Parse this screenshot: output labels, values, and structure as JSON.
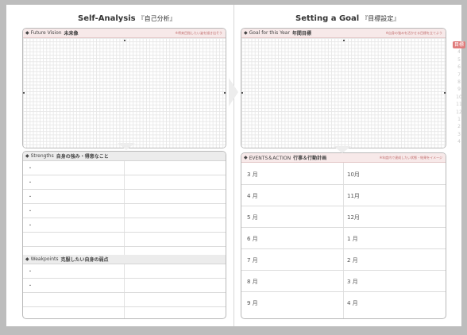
{
  "left_page": {
    "title": "Self-Analysis",
    "title_jp": "『自己分析』",
    "future_vision": {
      "label": "Future Vision",
      "label_jp": "未来像",
      "note": "※将来目指したい姿を描き出そう"
    },
    "strengths": {
      "label": "Strengths",
      "label_jp": "自身の強み・得意なこと",
      "bullets": [
        "・",
        "・",
        "・",
        "・",
        "・"
      ]
    },
    "weakpoints": {
      "label": "Weakpoints",
      "label_jp": "克服したい自身の弱点",
      "bullets": [
        "・",
        "・"
      ]
    }
  },
  "right_page": {
    "title": "Setting a Goal",
    "title_jp": "『目標設定』",
    "goal": {
      "label": "Goal for this Year",
      "label_jp": "年間目標",
      "note": "※自身の強みを活かせる目標を立てよう"
    },
    "events": {
      "label": "EVENTS＆ACTION",
      "label_jp": "行事＆行動計画",
      "note": "※年度内で達成したい状態・結果をイメージ",
      "months_left": [
        "3 月",
        "4 月",
        "5 月",
        "6 月",
        "7 月",
        "8 月",
        "9 月"
      ],
      "months_right": [
        "10月",
        "11月",
        "12月",
        "1 月",
        "2 月",
        "3 月",
        "4 月"
      ]
    }
  },
  "side_tabs": [
    "目標",
    "4",
    "5",
    "6",
    "7",
    "8",
    "9",
    "10",
    "11",
    "12",
    "1",
    "2",
    "3",
    "4"
  ]
}
